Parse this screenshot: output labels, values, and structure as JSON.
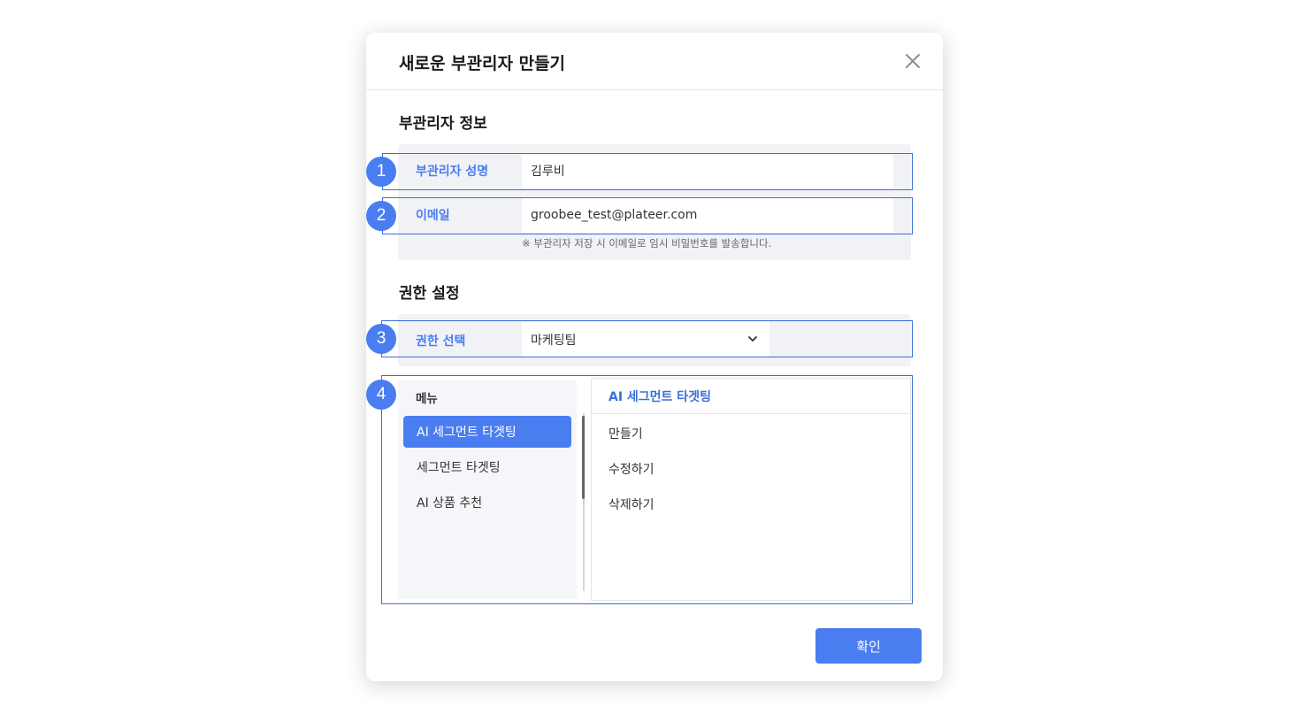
{
  "modal": {
    "title": "새로운 부관리자 만들기",
    "close_icon": "close-icon"
  },
  "info_section": {
    "title": "부관리자 정보",
    "name_label": "부관리자 성명",
    "name_value": "김루비",
    "email_label": "이메일",
    "email_value": "groobee_test@plateer.com",
    "hint": "※ 부관리자 저장 시 이메일로 임시 비밀번호를 발송합니다."
  },
  "permission_section": {
    "title": "권한 설정",
    "select_label": "권한 선택",
    "select_value": "마케팅팀",
    "select_icon": "chevron-down-icon"
  },
  "menu": {
    "header": "메뉴",
    "items": [
      {
        "label": "AI 세그먼트 타겟팅",
        "active": true
      },
      {
        "label": "세그먼트 타겟팅",
        "active": false
      },
      {
        "label": "AI 상품 추천",
        "active": false
      }
    ]
  },
  "detail": {
    "header": "AI 세그먼트 타겟팅",
    "items": [
      "만들기",
      "수정하기",
      "삭제하기"
    ]
  },
  "annotations": [
    "1",
    "2",
    "3",
    "4"
  ],
  "footer": {
    "confirm_label": "확인"
  },
  "colors": {
    "accent": "#4a7df0",
    "highlight_border": "#3b6fd8",
    "panel_bg": "#f1f2f6"
  }
}
